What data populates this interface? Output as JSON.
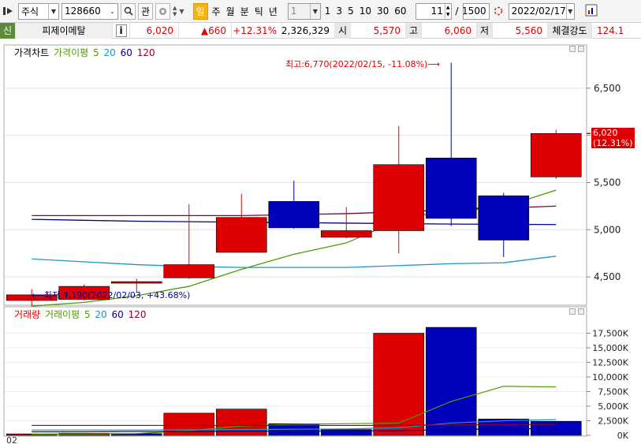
{
  "toolbar": {
    "market": "주식",
    "code": "128660",
    "gwan": "관",
    "periods": [
      "일",
      "주",
      "월",
      "분",
      "틱",
      "년"
    ],
    "selected_period": "일",
    "interval_value": "1",
    "intervals": [
      "1",
      "3",
      "5",
      "10",
      "30",
      "60"
    ],
    "count": "11",
    "slash": "/",
    "total": "1500",
    "date": "2022/02/17"
  },
  "info": {
    "badge": "신",
    "name": "피제이메탈",
    "info_icon": "i",
    "price": "6,020",
    "change": "▲660",
    "change_pct": "+12.31%",
    "volume": "2,326,329",
    "open_label": "시",
    "open": "5,570",
    "high_label": "고",
    "high": "6,060",
    "low_label": "저",
    "low": "5,560",
    "strength_label": "체결강도",
    "strength": "124.1"
  },
  "colors": {
    "up": "#dd0000",
    "down": "#0000bb",
    "ma5": "#4f9a00",
    "ma20": "#1a96c8",
    "ma60": "#00008b",
    "ma120": "#8b0030"
  },
  "price_legend": {
    "title": "가격차트",
    "ma_title": "가격이평",
    "p5": "5",
    "p20": "20",
    "p60": "60",
    "p120": "120"
  },
  "volume_legend": {
    "title": "거래량",
    "ma_title": "거래이평",
    "p5": "5",
    "p20": "20",
    "p60": "60",
    "p120": "120"
  },
  "annotations": {
    "high": "최고:6,770(2022/02/15, -11.08%)⟶",
    "low": "⟵최저:4,190(2022/02/03, +43.68%)",
    "last_price": "6,020",
    "last_pct": "(12.31%)",
    "bottom_label": "02"
  },
  "chart_data": [
    {
      "type": "candlestick",
      "title": "가격차트",
      "ylim": [
        4200,
        6900
      ],
      "yticks": [
        4500,
        5000,
        5500,
        6000,
        6500
      ],
      "ytick_labels": [
        "4,500",
        "5,000",
        "5,500",
        "",
        "6,500"
      ],
      "candles": [
        {
          "open": 4250,
          "close": 4310,
          "high": 4370,
          "low": 4190
        },
        {
          "open": 4260,
          "close": 4400,
          "high": 4420,
          "low": 4250
        },
        {
          "open": 4440,
          "close": 4450,
          "high": 4480,
          "low": 4330
        },
        {
          "open": 4490,
          "close": 4630,
          "high": 5270,
          "low": 4480
        },
        {
          "open": 4760,
          "close": 5130,
          "high": 5380,
          "low": 4760
        },
        {
          "open": 5300,
          "close": 5020,
          "high": 5520,
          "low": 5010
        },
        {
          "open": 4920,
          "close": 4990,
          "high": 5240,
          "low": 4910
        },
        {
          "open": 4990,
          "close": 5690,
          "high": 6100,
          "low": 4750
        },
        {
          "open": 5760,
          "close": 5120,
          "high": 6770,
          "low": 5040
        },
        {
          "open": 5360,
          "close": 4890,
          "high": 5390,
          "low": 4710
        },
        {
          "open": 5560,
          "close": 6020,
          "high": 6060,
          "low": 5540
        }
      ],
      "series": [
        {
          "name": "5",
          "values": [
            4190,
            4230,
            4300,
            4400,
            4580,
            4740,
            4860,
            5100,
            5220,
            5240,
            5420
          ]
        },
        {
          "name": "20",
          "values": [
            4690,
            4660,
            4630,
            4610,
            4600,
            4600,
            4600,
            4620,
            4640,
            4650,
            4720
          ]
        },
        {
          "name": "60",
          "values": [
            5110,
            5100,
            5090,
            5085,
            5080,
            5075,
            5070,
            5065,
            5060,
            5058,
            5055
          ]
        },
        {
          "name": "120",
          "values": [
            5150,
            5150,
            5150,
            5150,
            5150,
            5160,
            5170,
            5190,
            5210,
            5230,
            5250
          ]
        }
      ]
    },
    {
      "type": "bar",
      "title": "거래량",
      "ylim": [
        0,
        20000
      ],
      "yticks": [
        0,
        2500,
        5000,
        7500,
        10000,
        12500,
        15000,
        17500
      ],
      "ytick_labels": [
        "0K",
        "2,500K",
        "5,000K",
        "7,500K",
        "10,000K",
        "12,500K",
        "15,000K",
        "17,500K"
      ],
      "values": [
        250,
        350,
        300,
        3800,
        4500,
        2000,
        1000,
        17500,
        18500,
        2800,
        2400
      ],
      "directions": [
        "up",
        "up",
        "down",
        "up",
        "up",
        "down",
        "down",
        "up",
        "down",
        "down",
        "down"
      ],
      "series": [
        {
          "name": "5",
          "values": [
            200,
            250,
            300,
            800,
            1600,
            1900,
            2000,
            2100,
            5800,
            8400,
            8300
          ]
        },
        {
          "name": "20",
          "values": [
            900,
            900,
            900,
            950,
            1000,
            1050,
            1100,
            1300,
            2100,
            2500,
            2700
          ]
        },
        {
          "name": "60",
          "values": [
            600,
            600,
            650,
            650,
            700,
            700,
            750,
            800,
            1000,
            1100,
            1150
          ]
        },
        {
          "name": "120",
          "values": [
            1700,
            1700,
            1700,
            1700,
            1700,
            1700,
            1700,
            1700,
            1800,
            1850,
            1850
          ]
        }
      ]
    }
  ]
}
